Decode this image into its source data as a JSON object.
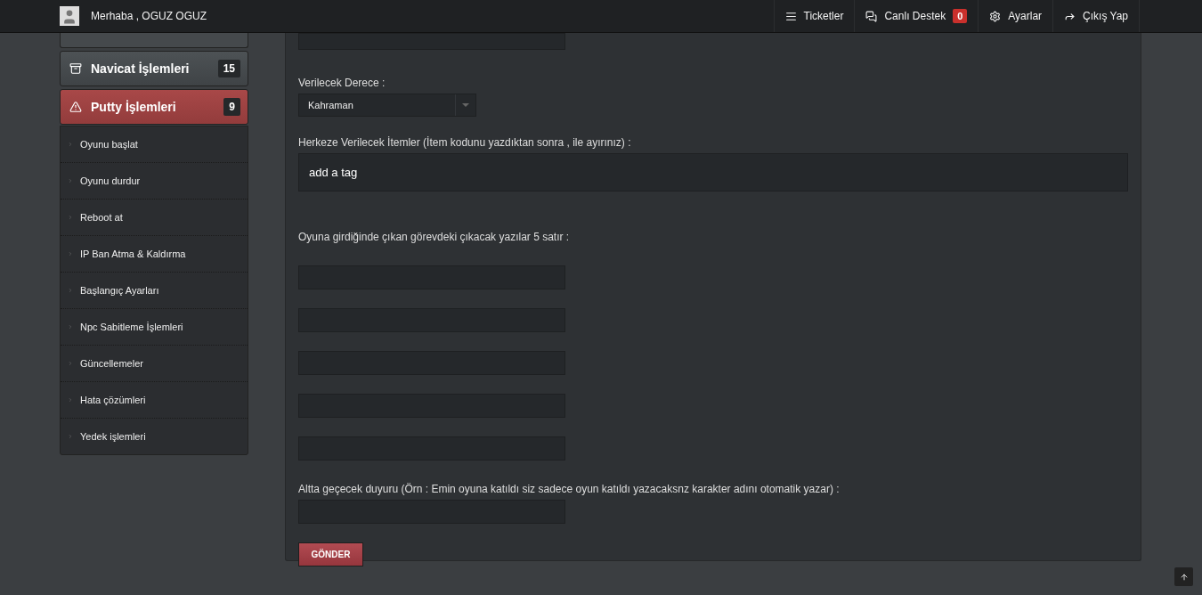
{
  "header": {
    "greeting": "Merhaba , OGUZ OGUZ",
    "nav": [
      {
        "label": "Ticketler"
      },
      {
        "label": "Canlı Destek",
        "badge": "0"
      },
      {
        "label": "Ayarlar"
      },
      {
        "label": "Çıkış Yap"
      }
    ]
  },
  "sidebar": {
    "items": [
      {
        "kind": "hidden",
        "selected": false
      },
      {
        "kind": "group",
        "label": "Navicat İşlemleri",
        "badge": "15",
        "selected": false
      },
      {
        "kind": "group",
        "label": "Putty İşlemleri",
        "badge": "9",
        "selected": true,
        "children": [
          {
            "label": "Oyunu başlat"
          },
          {
            "label": "Oyunu durdur"
          },
          {
            "label": "Reboot at"
          },
          {
            "label": "IP Ban Atma & Kaldırma"
          },
          {
            "label": "Başlangıç Ayarları"
          },
          {
            "label": "Npc Sabitleme İşlemleri"
          },
          {
            "label": "Güncellemeler"
          },
          {
            "label": "Hata çözümleri"
          },
          {
            "label": "Yedek işlemleri"
          }
        ]
      }
    ]
  },
  "form": {
    "fields": [
      {
        "kind": "partial-input"
      },
      {
        "kind": "select",
        "label": "Verilecek Derece :",
        "value": "Kahraman"
      },
      {
        "kind": "tags",
        "label": "Herkeze Verilecek İtemler (İtem kodunu yazdıktan sonra , ile ayırınız) :",
        "placeholder": "add a tag"
      },
      {
        "kind": "lines",
        "label": "Oyuna girdiğinde çıkan görevdeki çıkacak yazılar 5 satır :",
        "lines": [
          {
            "kind": "input"
          },
          {
            "kind": "input"
          },
          {
            "kind": "input"
          },
          {
            "kind": "input"
          },
          {
            "kind": "input"
          }
        ]
      },
      {
        "kind": "input",
        "label": "Altta geçecek duyuru (Örn : Emin oyuna katıldı siz sadece oyun katıldı yazacaksnz karakter adını otomatik yazar) :"
      }
    ],
    "submit": "GÖNDER"
  }
}
